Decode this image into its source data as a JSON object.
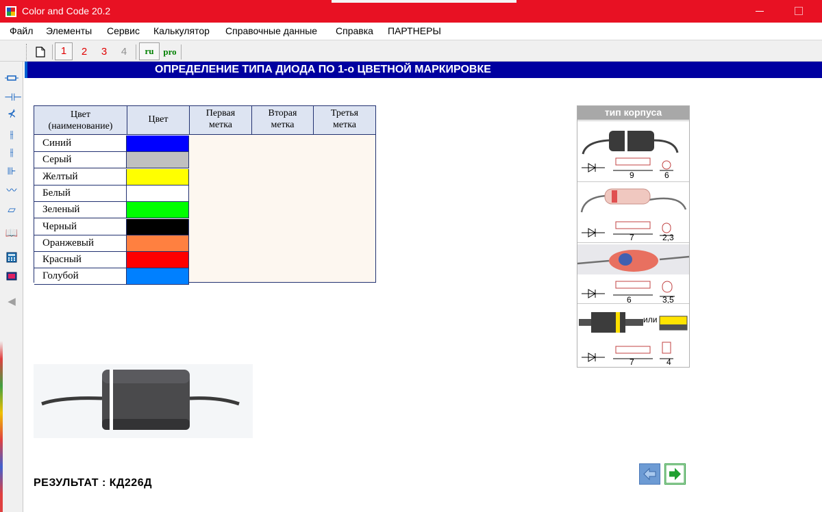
{
  "window": {
    "title": "Color and Code 20.2",
    "accent_color": "#e81123"
  },
  "menu": [
    "Файл",
    "Элементы",
    "Сервис",
    "Калькулятор",
    "Справочные данные",
    "Справка",
    "ПАРТНЕРЫ"
  ],
  "toolbar": {
    "new_icon": "new-document-icon",
    "marks": [
      "1",
      "2",
      "3",
      "4"
    ],
    "lang_ru": "ru",
    "lang_pro": "pro"
  },
  "left_tools": [
    "resistor-icon",
    "capacitor-icon",
    "diode-icon",
    "variable-capacitor-icon",
    "trimmer-capacitor-icon",
    "quartz-icon",
    "inductor-icon",
    "eraser-icon",
    "book-icon",
    "calculator-icon",
    "monitor-icon",
    "arrow-left-icon"
  ],
  "heading": "ОПРЕДЕЛЕНИЕ ТИПА ДИОДА ПО 1-о ЦВЕТНОЙ МАРКИРОВКЕ",
  "table": {
    "headers": {
      "color_name_1": "Цвет",
      "color_name_2": "(наименование)",
      "color": "Цвет",
      "first_1": "Первая",
      "first_2": "метка",
      "second_1": "Вторая",
      "second_2": "метка",
      "third_1": "Третья",
      "third_2": "метка"
    },
    "rows": [
      {
        "name": "Синий",
        "color": "#0000ff"
      },
      {
        "name": "Серый",
        "color": "#c0c0c0"
      },
      {
        "name": "Желтый",
        "color": "#ffff00"
      },
      {
        "name": "Белый",
        "color": "#ffffff"
      },
      {
        "name": "Зеленый",
        "color": "#00ff00"
      },
      {
        "name": "Черный",
        "color": "#000000"
      },
      {
        "name": "Оранжевый",
        "color": "#ff8040"
      },
      {
        "name": "Красный",
        "color": "#ff0000"
      },
      {
        "name": "Голубой",
        "color": "#0080ff"
      }
    ]
  },
  "case_panel": {
    "title": "тип корпуса",
    "items": [
      {
        "length": "9",
        "diameter": "6"
      },
      {
        "length": "7",
        "diameter": "2,3"
      },
      {
        "length": "6",
        "diameter": "3,5"
      },
      {
        "length": "7",
        "diameter": "4",
        "or_label": "или"
      }
    ]
  },
  "result": {
    "label": "РЕЗУЛЬТАТ :",
    "value": "КД226Д"
  }
}
